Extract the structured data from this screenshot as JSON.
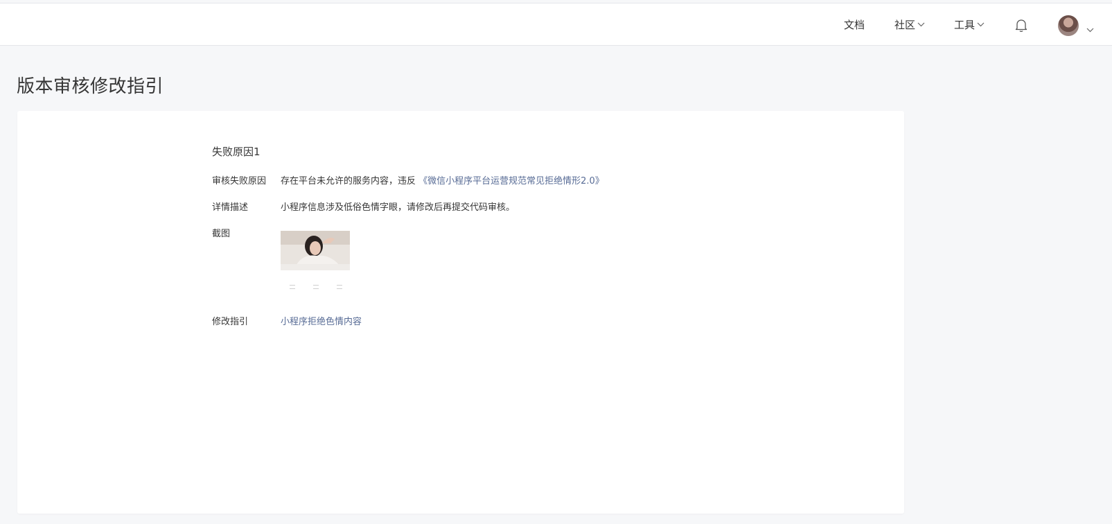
{
  "nav": {
    "docs": "文档",
    "community": "社区",
    "tools": "工具",
    "icons": [
      "chevron-down-icon",
      "bell-icon",
      "avatar"
    ]
  },
  "page": {
    "title": "版本审核修改指引"
  },
  "failure": {
    "section_title": "失败原因1",
    "reason_label": "审核失败原因",
    "reason_text": "存在平台未允许的服务内容，违反",
    "reason_link": "《微信小程序平台运营规范常见拒绝情形2.0》",
    "detail_label": "详情描述",
    "detail_text": "小程序信息涉及低俗色情字眼，请修改后再提交代码审核。",
    "screenshot_label": "截图",
    "guide_label": "修改指引",
    "guide_link": "小程序拒绝色情内容"
  },
  "colors": {
    "link": "#576b95",
    "text": "#353535",
    "background": "#f6f7f9"
  }
}
